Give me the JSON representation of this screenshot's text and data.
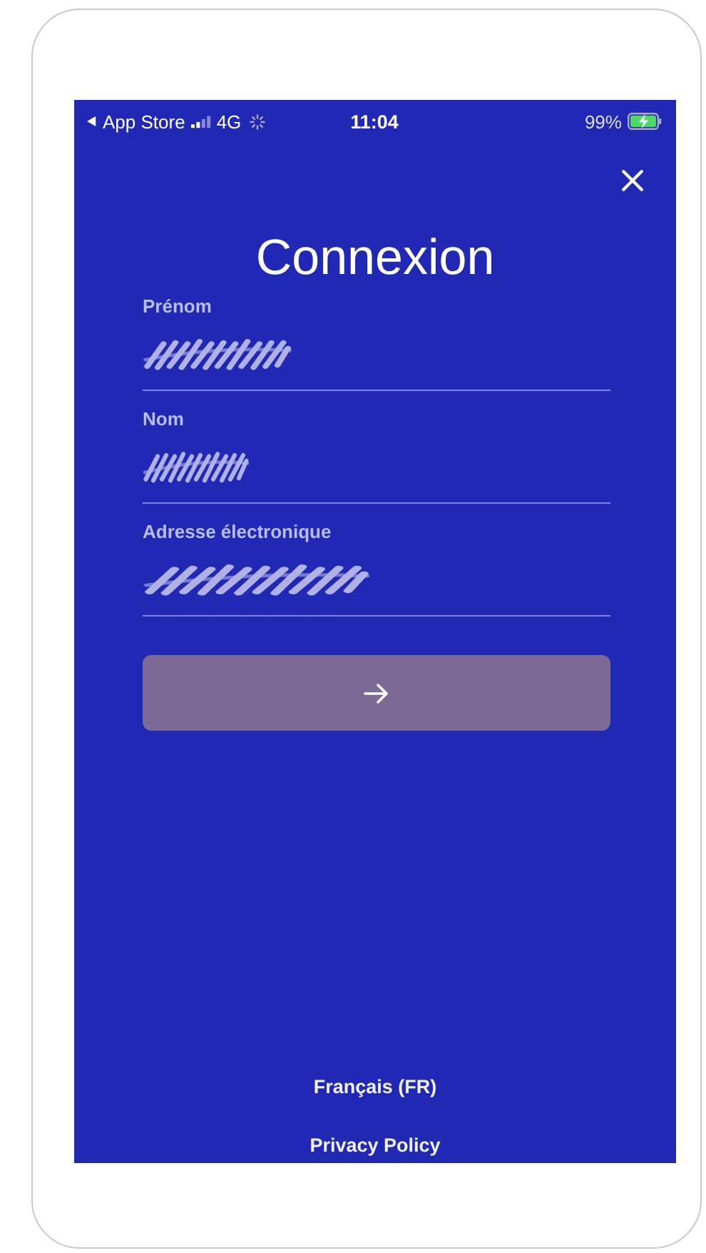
{
  "status_bar": {
    "back_label": "App Store",
    "network": "4G",
    "time": "11:04",
    "battery": "99%",
    "charging": true
  },
  "title": "Connexion",
  "fields": [
    {
      "label": "Prénom",
      "redacted": true
    },
    {
      "label": "Nom",
      "redacted": true
    },
    {
      "label": "Adresse électronique",
      "redacted": true
    }
  ],
  "submit": {
    "disabled": true
  },
  "footer": {
    "language": "Français (FR)",
    "privacy_link": "Privacy Policy"
  }
}
